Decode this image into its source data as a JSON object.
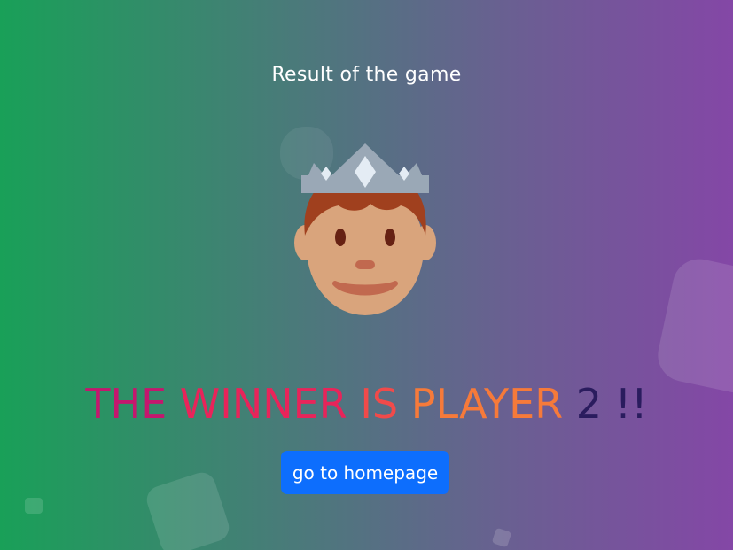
{
  "result": {
    "title": "Result of the game"
  },
  "winner": {
    "part1": "THE",
    "part2": "WINNER",
    "part3": "IS",
    "part4": "PLAYER",
    "player_number": "2",
    "exclaim": "!!"
  },
  "actions": {
    "homepage_label": "go to homepage"
  },
  "icons": {
    "winner": "crowned-prince-icon"
  },
  "colors": {
    "gradient_start": "#19a058",
    "gradient_end": "#8447a6",
    "button": "#0d6efd",
    "winner_text_gradient": [
      "#c4176e",
      "#e8245a",
      "#f14a4a",
      "#f67a3a",
      "#f6a12e",
      "#f7c21e",
      "#2a1c5e"
    ]
  }
}
